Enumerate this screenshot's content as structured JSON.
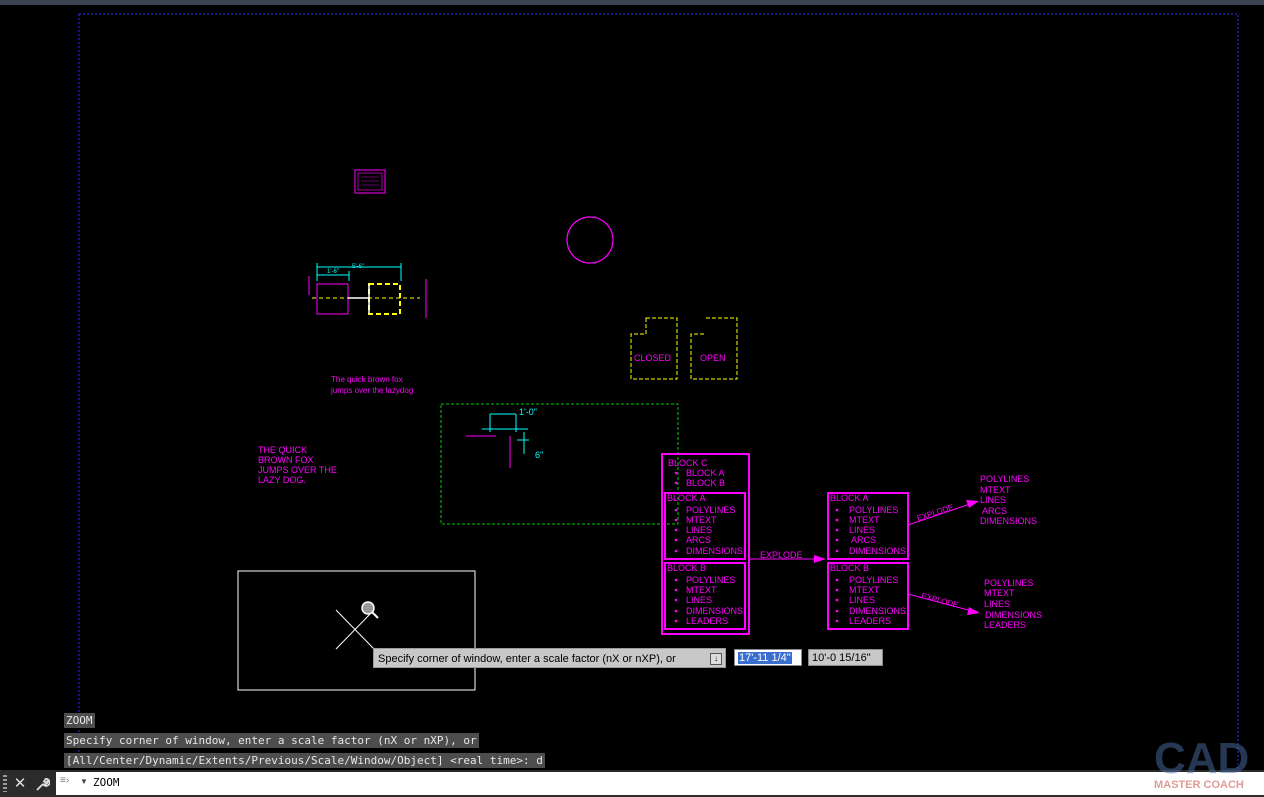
{
  "drawing": {
    "dim_small_1": "1'-6\"",
    "dim_small_2": "5'-6\"",
    "fox_text": [
      "The quick brown fox",
      "jumps over the lazydog"
    ],
    "fox_caps": [
      "THE QUICK",
      "BROWN FOX",
      "JUMPS OVER THE",
      "LAZY DOG."
    ],
    "closed_label": "CLOSED",
    "open_label": "OPEN",
    "dim_1ft": "1'-0\"",
    "dim_6in": "6\"",
    "block_c": {
      "title": "BLOCK C",
      "items": [
        "BLOCK A",
        "BLOCK B"
      ]
    },
    "block_a": {
      "title": "BLOCK A",
      "items": [
        "POLYLINES",
        "MTEXT",
        "LINES",
        "ARCS",
        "DIMENSIONS"
      ]
    },
    "block_b": {
      "title": "BLOCK B",
      "items": [
        "POLYLINES",
        "MTEXT",
        "LINES",
        "DIMENSIONS",
        "LEADERS"
      ]
    },
    "explode_label": "EXPLODE",
    "block_a2": {
      "title": "BLOCK A",
      "items": [
        "POLYLINES",
        "MTEXT",
        "LINES",
        "ARCS",
        "DIMENSIONS"
      ]
    },
    "block_b2": {
      "title": "BLOCK B",
      "items": [
        "POLYLINES",
        "MTEXT",
        "LINES",
        "DIMENSIONS",
        "LEADERS"
      ]
    },
    "explode_a": "EXPLODE",
    "explode_b": "EXPLODE",
    "result_a": [
      "POLYLINES",
      "MTEXT",
      "LINES",
      "ARCS",
      "DIMENSIONS"
    ],
    "result_b": [
      "POLYLINES",
      "MTEXT",
      "LINES",
      "DIMENSIONS",
      "LEADERS"
    ]
  },
  "tooltip": {
    "prompt": "Specify corner of window, enter a scale factor (nX or nXP), or",
    "icon": "download-arrow-icon"
  },
  "dynamic_input": {
    "value_1": "17'-11 1/4\"",
    "value_2": "10'-0 15/16\""
  },
  "command_history": [
    "ZOOM",
    "Specify corner of window, enter a scale factor (nX or nXP), or",
    "[All/Center/Dynamic/Extents/Previous/Scale/Window/Object] <real time>: d"
  ],
  "command_line": {
    "value": "ZOOM",
    "icons": [
      "grip-icon",
      "close-icon",
      "wrench-icon",
      "recent-commands-icon",
      "chevron-down-icon"
    ]
  },
  "watermark": {
    "line1": "CAD",
    "line2": "MASTER COACH"
  },
  "colors": {
    "magenta": "#ff00ff",
    "yellow": "#ffff00",
    "cyan": "#00ffff",
    "green": "#00cc00",
    "viewport_border": "#2a2aff",
    "background": "#000000"
  }
}
